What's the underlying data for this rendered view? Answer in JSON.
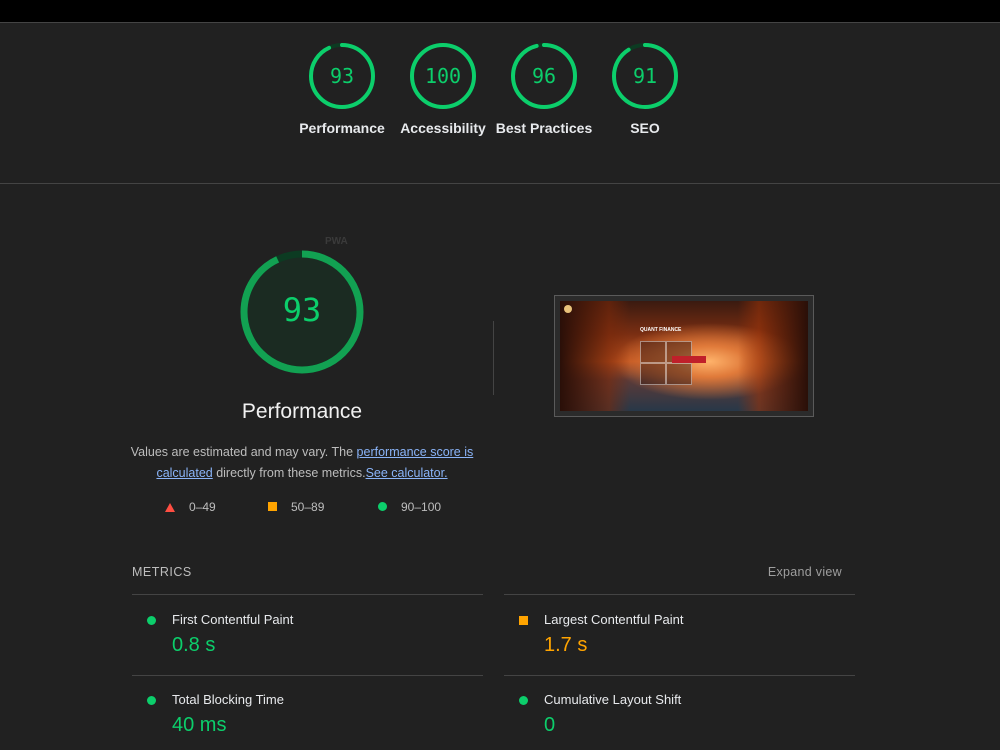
{
  "top_gauges": [
    {
      "score": "93",
      "label": "Performance",
      "fraction": 0.93
    },
    {
      "score": "100",
      "label": "Accessibility",
      "fraction": 1.0
    },
    {
      "score": "96",
      "label": "Best Practices",
      "fraction": 0.96
    },
    {
      "score": "91",
      "label": "SEO",
      "fraction": 0.91
    }
  ],
  "performance": {
    "score": "93",
    "fraction": 0.93,
    "pwa_badge": "PWA",
    "title": "Performance",
    "desc_prefix": "Values are estimated and may vary. The ",
    "desc_link1": "performance score is calculated",
    "desc_middle": " directly from these metrics.",
    "desc_link2": "See calculator."
  },
  "legend": {
    "fail": "0–49",
    "average": "50–89",
    "pass": "90–100"
  },
  "screenshot": {
    "page_title": "QUANT FINANCE"
  },
  "metrics": {
    "heading": "METRICS",
    "expand_label": "Expand view",
    "items": [
      {
        "name": "First Contentful Paint",
        "value": "0.8 s",
        "rating": "pass"
      },
      {
        "name": "Largest Contentful Paint",
        "value": "1.7 s",
        "rating": "average"
      },
      {
        "name": "Total Blocking Time",
        "value": "40 ms",
        "rating": "pass"
      },
      {
        "name": "Cumulative Layout Shift",
        "value": "0",
        "rating": "pass"
      }
    ]
  },
  "colors": {
    "pass": "#0cce6b",
    "average": "#ffa400",
    "fail": "#ff4e42",
    "background": "#212121"
  },
  "icons": [
    "triangle-fail-icon",
    "square-average-icon",
    "circle-pass-icon"
  ]
}
